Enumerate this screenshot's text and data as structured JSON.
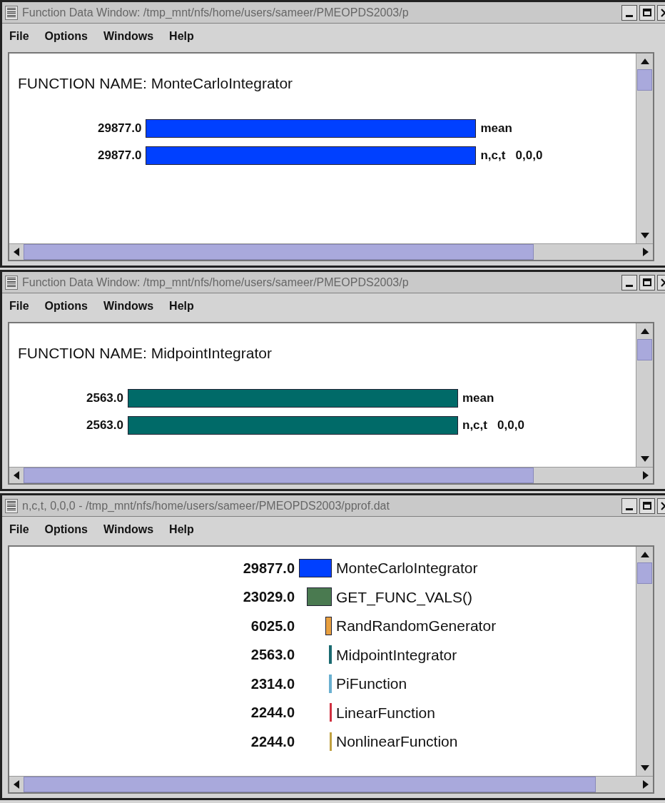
{
  "windows": [
    {
      "title": "Function Data Window: /tmp_mnt/nfs/home/users/sameer/PMEOPDS2003/p",
      "kind": "function",
      "menu": [
        "File",
        "Options",
        "Windows",
        "Help"
      ],
      "function_name": "FUNCTION NAME: MonteCarloIntegrator",
      "bars": [
        {
          "value": "29877.0",
          "label": "mean",
          "color": "#0040ff"
        },
        {
          "value": "29877.0",
          "label": "n,c,t   0,0,0",
          "color": "#0040ff"
        }
      ]
    },
    {
      "title": "Function Data Window: /tmp_mnt/nfs/home/users/sameer/PMEOPDS2003/p",
      "kind": "function",
      "menu": [
        "File",
        "Options",
        "Windows",
        "Help"
      ],
      "function_name": "FUNCTION NAME: MidpointIntegrator",
      "bars": [
        {
          "value": "2563.0",
          "label": "mean",
          "color": "#006a68"
        },
        {
          "value": "2563.0",
          "label": "n,c,t   0,0,0",
          "color": "#006a68"
        }
      ]
    },
    {
      "title": "n,c,t, 0,0,0 - /tmp_mnt/nfs/home/users/sameer/PMEOPDS2003/pprof.dat",
      "kind": "list",
      "menu": [
        "File",
        "Options",
        "Windows",
        "Help"
      ],
      "bars": [
        {
          "value": "29877.0",
          "label": "MonteCarloIntegrator",
          "color": "#0040ff"
        },
        {
          "value": "23029.0",
          "label": "GET_FUNC_VALS()",
          "color": "#4a7a50"
        },
        {
          "value": "6025.0",
          "label": "RandRandomGenerator",
          "color": "#e8a040"
        },
        {
          "value": "2563.0",
          "label": "MidpointIntegrator",
          "color": "#1a6a70"
        },
        {
          "value": "2314.0",
          "label": "PiFunction",
          "color": "#6ab0d0"
        },
        {
          "value": "2244.0",
          "label": "LinearFunction",
          "color": "#d03040"
        },
        {
          "value": "2244.0",
          "label": "NonlinearFunction",
          "color": "#c0a040"
        }
      ]
    }
  ]
}
